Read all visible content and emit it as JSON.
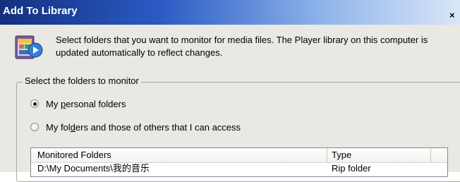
{
  "window": {
    "title": "Add To Library",
    "close_glyph": "×"
  },
  "description": "Select folders that you want to monitor for media files. The Player library on this computer is updated automatically to reflect changes.",
  "group": {
    "legend": "Select the folders to monitor",
    "options": [
      {
        "prefix": "My ",
        "accel": "p",
        "suffix": "ersonal folders",
        "selected": true
      },
      {
        "prefix": "My fol",
        "accel": "d",
        "suffix": "ers and those of others that I can access",
        "selected": false
      }
    ]
  },
  "list": {
    "columns": [
      "Monitored Folders",
      "Type"
    ],
    "rows": [
      {
        "folder": "D:\\My Documents\\我的音乐",
        "type": "Rip folder"
      }
    ]
  },
  "icons": {
    "media": "media-library-icon",
    "close": "close-icon"
  }
}
